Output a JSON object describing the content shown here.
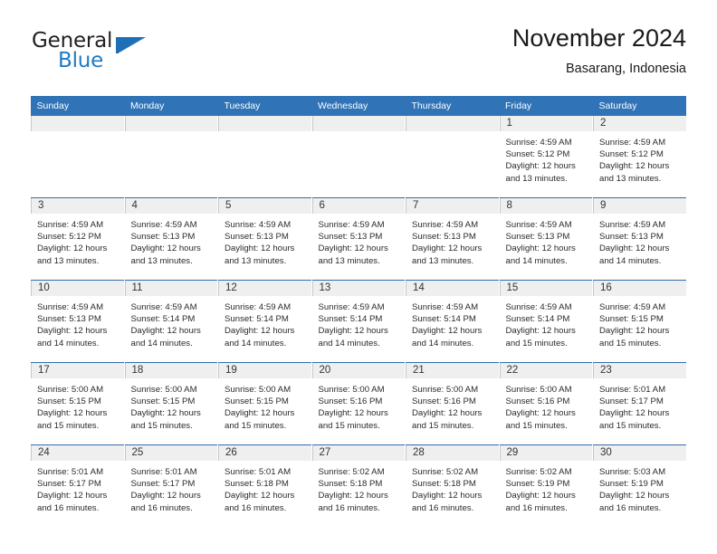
{
  "brand": {
    "name_part1": "General",
    "name_part2": "Blue"
  },
  "header": {
    "title": "November 2024",
    "subtitle": "Basarang, Indonesia"
  },
  "calendar": {
    "weekday_headers": [
      "Sunday",
      "Monday",
      "Tuesday",
      "Wednesday",
      "Thursday",
      "Friday",
      "Saturday"
    ],
    "labels": {
      "sunrise": "Sunrise:",
      "sunset": "Sunset:",
      "daylight": "Daylight:"
    },
    "accent_color": "#3073b7",
    "daynum_band_color": "#efefef",
    "weeks": [
      [
        {
          "day": "",
          "empty": true
        },
        {
          "day": "",
          "empty": true
        },
        {
          "day": "",
          "empty": true
        },
        {
          "day": "",
          "empty": true
        },
        {
          "day": "",
          "empty": true
        },
        {
          "day": "1",
          "sunrise": "Sunrise: 4:59 AM",
          "sunset": "Sunset: 5:12 PM",
          "daylight1": "Daylight: 12 hours",
          "daylight2": "and 13 minutes."
        },
        {
          "day": "2",
          "sunrise": "Sunrise: 4:59 AM",
          "sunset": "Sunset: 5:12 PM",
          "daylight1": "Daylight: 12 hours",
          "daylight2": "and 13 minutes."
        }
      ],
      [
        {
          "day": "3",
          "sunrise": "Sunrise: 4:59 AM",
          "sunset": "Sunset: 5:12 PM",
          "daylight1": "Daylight: 12 hours",
          "daylight2": "and 13 minutes."
        },
        {
          "day": "4",
          "sunrise": "Sunrise: 4:59 AM",
          "sunset": "Sunset: 5:13 PM",
          "daylight1": "Daylight: 12 hours",
          "daylight2": "and 13 minutes."
        },
        {
          "day": "5",
          "sunrise": "Sunrise: 4:59 AM",
          "sunset": "Sunset: 5:13 PM",
          "daylight1": "Daylight: 12 hours",
          "daylight2": "and 13 minutes."
        },
        {
          "day": "6",
          "sunrise": "Sunrise: 4:59 AM",
          "sunset": "Sunset: 5:13 PM",
          "daylight1": "Daylight: 12 hours",
          "daylight2": "and 13 minutes."
        },
        {
          "day": "7",
          "sunrise": "Sunrise: 4:59 AM",
          "sunset": "Sunset: 5:13 PM",
          "daylight1": "Daylight: 12 hours",
          "daylight2": "and 13 minutes."
        },
        {
          "day": "8",
          "sunrise": "Sunrise: 4:59 AM",
          "sunset": "Sunset: 5:13 PM",
          "daylight1": "Daylight: 12 hours",
          "daylight2": "and 14 minutes."
        },
        {
          "day": "9",
          "sunrise": "Sunrise: 4:59 AM",
          "sunset": "Sunset: 5:13 PM",
          "daylight1": "Daylight: 12 hours",
          "daylight2": "and 14 minutes."
        }
      ],
      [
        {
          "day": "10",
          "sunrise": "Sunrise: 4:59 AM",
          "sunset": "Sunset: 5:13 PM",
          "daylight1": "Daylight: 12 hours",
          "daylight2": "and 14 minutes."
        },
        {
          "day": "11",
          "sunrise": "Sunrise: 4:59 AM",
          "sunset": "Sunset: 5:14 PM",
          "daylight1": "Daylight: 12 hours",
          "daylight2": "and 14 minutes."
        },
        {
          "day": "12",
          "sunrise": "Sunrise: 4:59 AM",
          "sunset": "Sunset: 5:14 PM",
          "daylight1": "Daylight: 12 hours",
          "daylight2": "and 14 minutes."
        },
        {
          "day": "13",
          "sunrise": "Sunrise: 4:59 AM",
          "sunset": "Sunset: 5:14 PM",
          "daylight1": "Daylight: 12 hours",
          "daylight2": "and 14 minutes."
        },
        {
          "day": "14",
          "sunrise": "Sunrise: 4:59 AM",
          "sunset": "Sunset: 5:14 PM",
          "daylight1": "Daylight: 12 hours",
          "daylight2": "and 14 minutes."
        },
        {
          "day": "15",
          "sunrise": "Sunrise: 4:59 AM",
          "sunset": "Sunset: 5:14 PM",
          "daylight1": "Daylight: 12 hours",
          "daylight2": "and 15 minutes."
        },
        {
          "day": "16",
          "sunrise": "Sunrise: 4:59 AM",
          "sunset": "Sunset: 5:15 PM",
          "daylight1": "Daylight: 12 hours",
          "daylight2": "and 15 minutes."
        }
      ],
      [
        {
          "day": "17",
          "sunrise": "Sunrise: 5:00 AM",
          "sunset": "Sunset: 5:15 PM",
          "daylight1": "Daylight: 12 hours",
          "daylight2": "and 15 minutes."
        },
        {
          "day": "18",
          "sunrise": "Sunrise: 5:00 AM",
          "sunset": "Sunset: 5:15 PM",
          "daylight1": "Daylight: 12 hours",
          "daylight2": "and 15 minutes."
        },
        {
          "day": "19",
          "sunrise": "Sunrise: 5:00 AM",
          "sunset": "Sunset: 5:15 PM",
          "daylight1": "Daylight: 12 hours",
          "daylight2": "and 15 minutes."
        },
        {
          "day": "20",
          "sunrise": "Sunrise: 5:00 AM",
          "sunset": "Sunset: 5:16 PM",
          "daylight1": "Daylight: 12 hours",
          "daylight2": "and 15 minutes."
        },
        {
          "day": "21",
          "sunrise": "Sunrise: 5:00 AM",
          "sunset": "Sunset: 5:16 PM",
          "daylight1": "Daylight: 12 hours",
          "daylight2": "and 15 minutes."
        },
        {
          "day": "22",
          "sunrise": "Sunrise: 5:00 AM",
          "sunset": "Sunset: 5:16 PM",
          "daylight1": "Daylight: 12 hours",
          "daylight2": "and 15 minutes."
        },
        {
          "day": "23",
          "sunrise": "Sunrise: 5:01 AM",
          "sunset": "Sunset: 5:17 PM",
          "daylight1": "Daylight: 12 hours",
          "daylight2": "and 15 minutes."
        }
      ],
      [
        {
          "day": "24",
          "sunrise": "Sunrise: 5:01 AM",
          "sunset": "Sunset: 5:17 PM",
          "daylight1": "Daylight: 12 hours",
          "daylight2": "and 16 minutes."
        },
        {
          "day": "25",
          "sunrise": "Sunrise: 5:01 AM",
          "sunset": "Sunset: 5:17 PM",
          "daylight1": "Daylight: 12 hours",
          "daylight2": "and 16 minutes."
        },
        {
          "day": "26",
          "sunrise": "Sunrise: 5:01 AM",
          "sunset": "Sunset: 5:18 PM",
          "daylight1": "Daylight: 12 hours",
          "daylight2": "and 16 minutes."
        },
        {
          "day": "27",
          "sunrise": "Sunrise: 5:02 AM",
          "sunset": "Sunset: 5:18 PM",
          "daylight1": "Daylight: 12 hours",
          "daylight2": "and 16 minutes."
        },
        {
          "day": "28",
          "sunrise": "Sunrise: 5:02 AM",
          "sunset": "Sunset: 5:18 PM",
          "daylight1": "Daylight: 12 hours",
          "daylight2": "and 16 minutes."
        },
        {
          "day": "29",
          "sunrise": "Sunrise: 5:02 AM",
          "sunset": "Sunset: 5:19 PM",
          "daylight1": "Daylight: 12 hours",
          "daylight2": "and 16 minutes."
        },
        {
          "day": "30",
          "sunrise": "Sunrise: 5:03 AM",
          "sunset": "Sunset: 5:19 PM",
          "daylight1": "Daylight: 12 hours",
          "daylight2": "and 16 minutes."
        }
      ]
    ]
  }
}
